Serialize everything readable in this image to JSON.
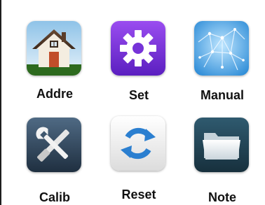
{
  "apps": [
    {
      "label": "Addre",
      "icon": "house-icon"
    },
    {
      "label": "Set",
      "icon": "gear-icon"
    },
    {
      "label": "Manual",
      "icon": "network-globe-icon"
    },
    {
      "label": "Calib",
      "icon": "tools-icon"
    },
    {
      "label": "Reset",
      "icon": "refresh-icon"
    },
    {
      "label": "Note",
      "icon": "folder-icon"
    }
  ]
}
